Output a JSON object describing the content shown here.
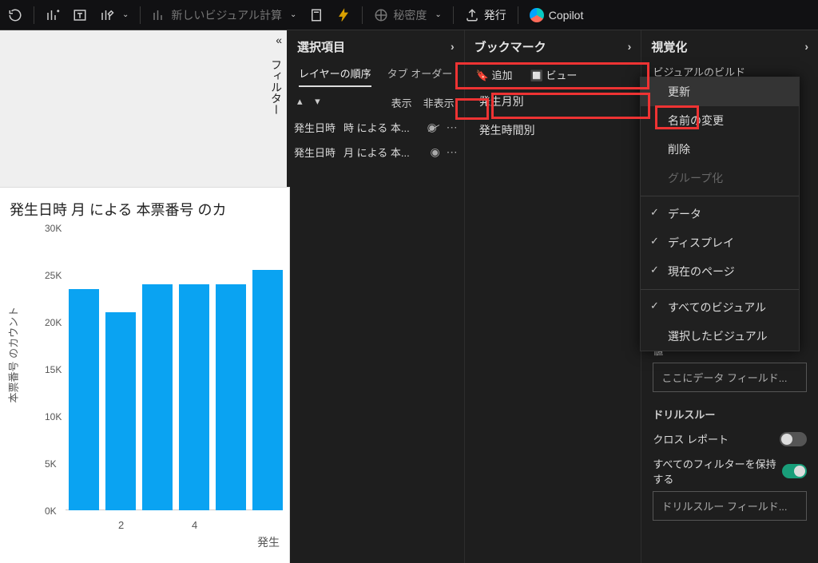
{
  "toolbar": {
    "new_visual_calc": "新しいビジュアル計算",
    "sensitivity": "秘密度",
    "publish": "発行",
    "copilot": "Copilot"
  },
  "filter_tab": "フィルター",
  "chart_data": {
    "type": "bar",
    "title": "発生日時 月 による 本票番号 のカ",
    "xlabel": "発生",
    "ylabel": "本票番号 のカウント",
    "categories": [
      "1",
      "2",
      "3",
      "4",
      "5",
      "6"
    ],
    "values": [
      23500,
      21000,
      24000,
      24000,
      24000,
      25500
    ],
    "ylim": [
      0,
      30000
    ],
    "yticks": [
      "0K",
      "5K",
      "10K",
      "15K",
      "20K",
      "25K",
      "30K"
    ],
    "xticks_shown": [
      "2",
      "4"
    ]
  },
  "selection": {
    "title": "選択項目",
    "tab_layer": "レイヤーの順序",
    "tab_tab": "タブ オーダー",
    "show": "表示",
    "hide": "非表示",
    "rows": [
      {
        "name": "発生日時",
        "detail": "時 による 本..."
      },
      {
        "name": "発生日時",
        "detail": "月 による 本..."
      }
    ]
  },
  "bookmarks": {
    "title": "ブックマーク",
    "add": "追加",
    "view": "ビュー",
    "items": [
      "発生月別",
      "発生時間別"
    ]
  },
  "visualize": {
    "title": "視覚化",
    "build": "ビジュアルのビルド",
    "values": "値",
    "values_placeholder": "ここにデータ フィールド...",
    "drillthrough": "ドリルスルー",
    "cross_report": "クロス レポート",
    "keep_filters": "すべてのフィルターを保持する",
    "drill_field": "ドリルスルー フィールド..."
  },
  "context_menu": {
    "update": "更新",
    "rename": "名前の変更",
    "delete": "削除",
    "group": "グループ化",
    "data": "データ",
    "display": "ディスプレイ",
    "current_page": "現在のページ",
    "all_visuals": "すべてのビジュアル",
    "selected_visuals": "選択したビジュアル"
  }
}
